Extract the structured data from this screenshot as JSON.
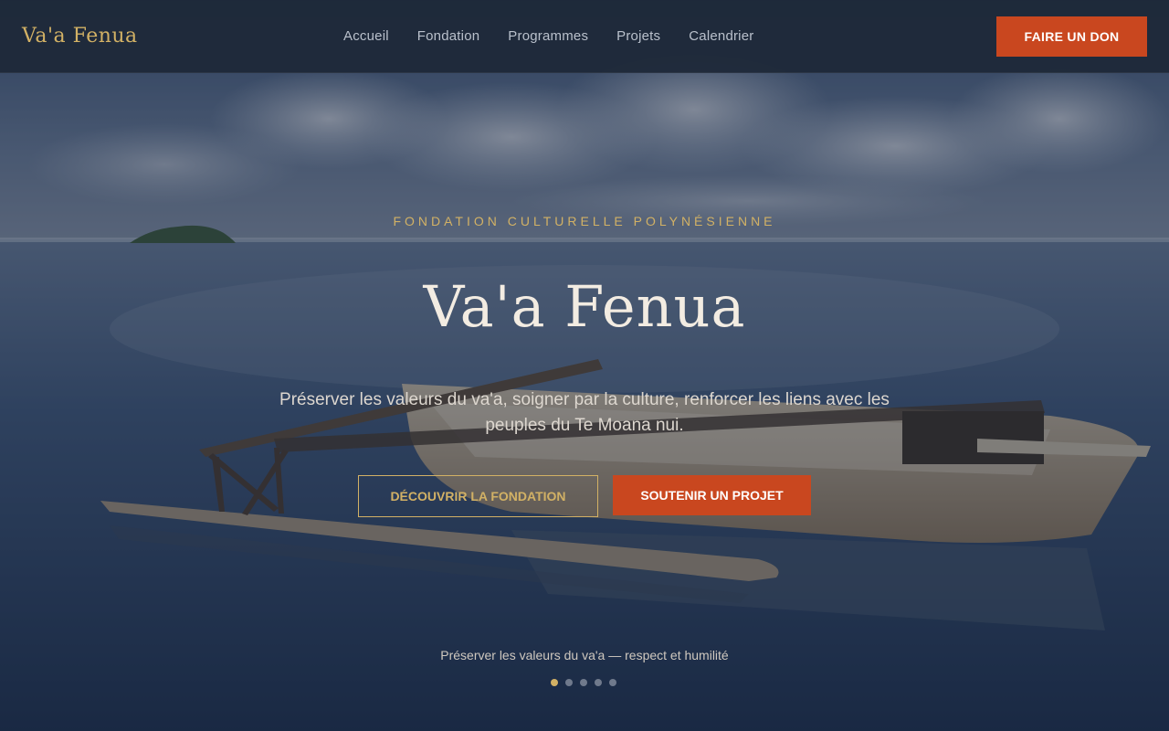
{
  "nav": {
    "logo": "Va'a Fenua",
    "links": [
      "Accueil",
      "Fondation",
      "Programmes",
      "Projets",
      "Calendrier"
    ],
    "donate_label": "FAIRE UN DON"
  },
  "hero": {
    "eyebrow": "FONDATION CULTURELLE POLYNÉSIENNE",
    "title": "Va'a Fenua",
    "tagline": "Préserver les valeurs du va'a, soigner par la culture, renforcer les liens avec les peuples du Te Moana nui.",
    "primary_cta": "DÉCOUVRIR LA FONDATION",
    "secondary_cta": "SOUTENIR UN PROJET",
    "slide_caption": "Préserver les valeurs du va'a — respect et humilité",
    "slides": {
      "count": 5,
      "active": 1
    }
  },
  "colors": {
    "accent_gold": "#d2b165",
    "accent_orange": "#c9471f",
    "nav_background": "#1e2838",
    "overlay": "#16223a"
  },
  "image": {
    "subject": "outrigger-canoe-lagoon-photo"
  }
}
